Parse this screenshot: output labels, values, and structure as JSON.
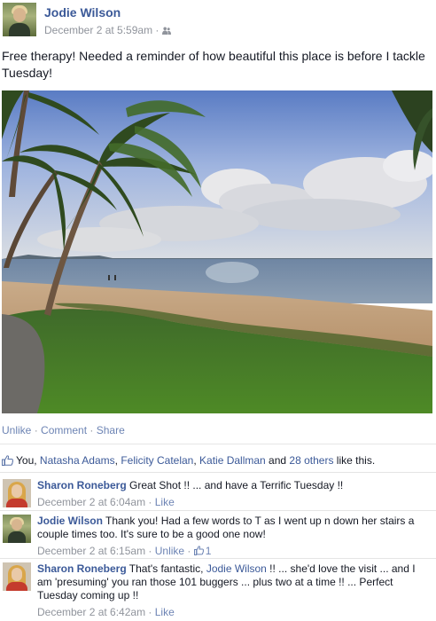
{
  "post": {
    "author": "Jodie Wilson",
    "timestamp": "December 2 at 5:59am",
    "meta_separator": "·",
    "audience_icon": "friends-icon",
    "text": "Free therapy! Needed a reminder of how beautiful this place is before I tackle Tuesday!",
    "photo_icon": "beach-photo"
  },
  "actions": {
    "unlike": "Unlike",
    "sep1": " · ",
    "comment": "Comment",
    "sep2": " · ",
    "share": "Share"
  },
  "likes": {
    "you": "You, ",
    "person1": "Natasha Adams",
    "sep1": ", ",
    "person2": "Felicity Catelan",
    "sep2": ", ",
    "person3": "Katie Dallman",
    "and": " and ",
    "others": "28 others",
    "suffix": " like this."
  },
  "comments": [
    {
      "author": "Sharon Roneberg",
      "text": " Great Shot !! ... and have a Terrific Tuesday !!",
      "timestamp": "December 2 at 6:04am",
      "sep": " · ",
      "action": "Like"
    },
    {
      "author": "Jodie Wilson",
      "text": " Thank you! Had a few words to T as I went up n down her stairs a couple times too. It's sure to be a good one now!",
      "timestamp": "December 2 at 6:15am",
      "sep": " · ",
      "action": "Unlike",
      "sep2": " · ",
      "like_count": "1"
    },
    {
      "author": "Sharon Roneberg",
      "text_before": " That's fantastic, ",
      "mention": "Jodie Wilson",
      "text_after": " !! ... she'd love the visit ... and I am 'presuming' you ran those 101 buggers ... plus two at a time !! ... Perfect Tuesday coming up !!",
      "timestamp": "December 2 at 6:42am",
      "sep": " · ",
      "action": "Like"
    }
  ],
  "colors": {
    "link": "#3b5998",
    "action_link": "#6d84b4",
    "meta": "#90949c",
    "text": "#141823"
  }
}
